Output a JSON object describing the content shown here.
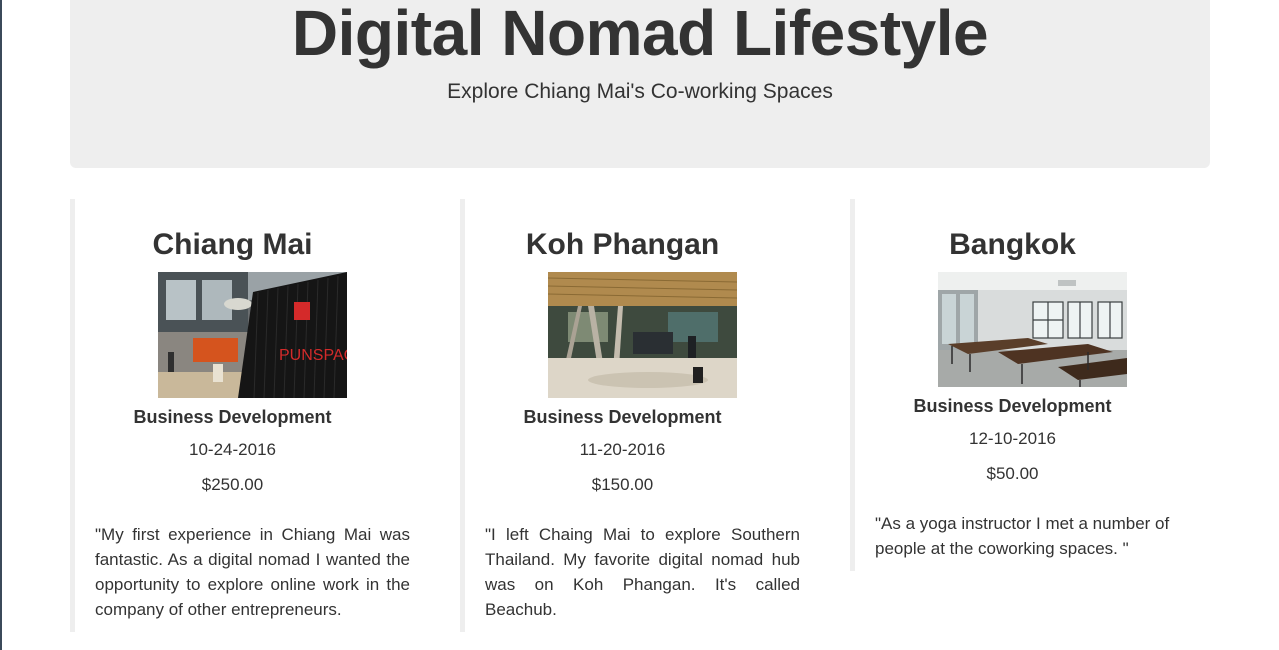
{
  "header": {
    "title": "Digital Nomad Lifestyle",
    "subtitle": "Explore Chiang Mai's Co-working Spaces"
  },
  "cards": [
    {
      "city": "Chiang Mai",
      "image_icon": "coworking-photo-punspace",
      "image_sign_text": "PUNSPACE",
      "category": "Business Development",
      "date": "10-24-2016",
      "price": "$250.00",
      "quote": "\"My first experience in Chiang Mai was fantastic. As a digital nomad I wanted the opportunity to explore online work in the company of other entrepreneurs."
    },
    {
      "city": "Koh Phangan",
      "image_icon": "coworking-photo-beachub",
      "category": "Business Development",
      "date": "11-20-2016",
      "price": "$150.00",
      "quote": "\"I left Chaing Mai to explore Southern Thailand. My favorite digital nomad hub was on Koh Phangan. It's called Beachub."
    },
    {
      "city": "Bangkok",
      "image_icon": "coworking-photo-bangkok",
      "category": "Business Development",
      "date": "12-10-2016",
      "price": "$50.00",
      "quote": "\"As a yoga instructor I met a number of people at the coworking spaces. \""
    }
  ],
  "colors": {
    "jumbotron_bg": "#eeeeee",
    "text": "#333333",
    "column_border": "#eeeeee"
  }
}
